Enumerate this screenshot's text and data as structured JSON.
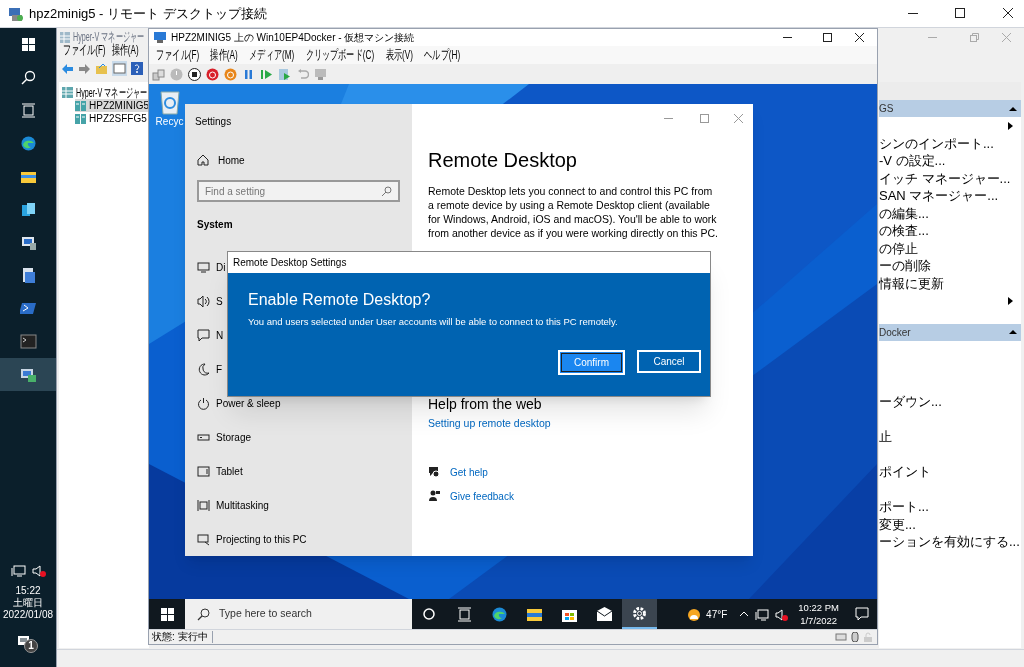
{
  "rdp_window": {
    "title": "hpz2minig5 - リモート デスクトップ接続"
  },
  "host_taskbar": {
    "items": [
      {
        "kind": "windows",
        "selected": false
      },
      {
        "kind": "search",
        "selected": false
      },
      {
        "kind": "taskview",
        "selected": false
      },
      {
        "kind": "edge",
        "selected": false
      },
      {
        "kind": "folder",
        "selected": false
      },
      {
        "kind": "app",
        "selected": false
      },
      {
        "kind": "server",
        "selected": false
      },
      {
        "kind": "document",
        "selected": false
      },
      {
        "kind": "powershell",
        "selected": false
      },
      {
        "kind": "terminal",
        "selected": false
      },
      {
        "kind": "hyperv",
        "selected": true
      }
    ],
    "time": "15:22",
    "day": "土曜日",
    "date": "2022/01/08",
    "notification_count": "1"
  },
  "hyperv_manager": {
    "title": "Hyper-V マネージャー",
    "menu": [
      "ファイル(F)",
      "操作(A)"
    ],
    "tree": [
      {
        "label": "Hyper-V マネージャー",
        "selected": false,
        "children": [
          {
            "label": "HPZ2MINIG5",
            "selected": true
          },
          {
            "label": "HPZ2SFFG5",
            "selected": false
          }
        ]
      }
    ],
    "actions": [
      {
        "header": "GS",
        "items": [
          {
            "kind": "submenu"
          },
          {
            "kind": "text",
            "label": "シンのインポート..."
          },
          {
            "kind": "text",
            "label": "-V の設定..."
          },
          {
            "kind": "text",
            "label": "イッチ マネージャー..."
          },
          {
            "kind": "text",
            "label": "SAN マネージャー..."
          },
          {
            "kind": "text",
            "label": "の編集..."
          },
          {
            "kind": "text",
            "label": "の検査..."
          },
          {
            "kind": "text",
            "label": "の停止"
          },
          {
            "kind": "text",
            "label": "ーの削除"
          },
          {
            "kind": "text",
            "label": "情報に更新"
          },
          {
            "kind": "submenu"
          }
        ]
      },
      {
        "header": "Docker",
        "items": [
          {
            "kind": "blank"
          },
          {
            "kind": "blank"
          },
          {
            "kind": "blank"
          },
          {
            "kind": "text",
            "label": "ーダウン..."
          },
          {
            "kind": "blank"
          },
          {
            "kind": "text",
            "label": "止"
          },
          {
            "kind": "blank"
          },
          {
            "kind": "text",
            "label": "ポイント"
          },
          {
            "kind": "blank"
          },
          {
            "kind": "text",
            "label": "ポート..."
          },
          {
            "kind": "text",
            "label": "変更..."
          },
          {
            "kind": "text",
            "label": "ーションを有効にする..."
          }
        ]
      }
    ]
  },
  "vm_window": {
    "title": "HPZ2MINIG5 上の Win10EP4Docker - 仮想マシン接続",
    "menu": [
      "ファイル(F)",
      "操作(A)",
      "メディア(M)",
      "クリップボード(C)",
      "表示(V)",
      "ヘルプ(H)"
    ],
    "status": "状態: 実行中"
  },
  "guest": {
    "desktop_icons": [
      {
        "label": "Recyc"
      }
    ],
    "settings": {
      "title": "Settings",
      "home": "Home",
      "search_placeholder": "Find a setting",
      "section": "System",
      "nav": [
        {
          "kind": "display",
          "label": "Di"
        },
        {
          "kind": "sound",
          "label": "S"
        },
        {
          "kind": "notifications",
          "label": "N"
        },
        {
          "kind": "focus",
          "label": "F"
        },
        {
          "kind": "power",
          "label": "Power & sleep"
        },
        {
          "kind": "storage",
          "label": "Storage"
        },
        {
          "kind": "tablet",
          "label": "Tablet"
        },
        {
          "kind": "multitasking",
          "label": "Multitasking"
        },
        {
          "kind": "projecting",
          "label": "Projecting to this PC"
        }
      ],
      "heading": "Remote Desktop",
      "description": "Remote Desktop lets you connect to and control this PC from a remote device by using a Remote Desktop client (available for Windows, Android, iOS and macOS). You'll be able to work from another device as if you were working directly on this PC.",
      "help_heading": "Help from the web",
      "help_links": [
        "Setting up remote desktop"
      ],
      "support_links": [
        {
          "kind": "help",
          "label": "Get help"
        },
        {
          "kind": "feedback",
          "label": "Give feedback"
        }
      ]
    },
    "dialog": {
      "title": "Remote Desktop Settings",
      "heading": "Enable Remote Desktop?",
      "message": "You and users selected under User accounts will be able to connect to this PC remotely.",
      "buttons": [
        {
          "label": "Confirm",
          "default": true
        },
        {
          "label": "Cancel",
          "default": false
        }
      ]
    },
    "taskbar": {
      "search_placeholder": "Type here to search",
      "apps": [
        {
          "kind": "cortana",
          "selected": false
        },
        {
          "kind": "taskview",
          "selected": false
        },
        {
          "kind": "edge",
          "selected": false
        },
        {
          "kind": "explorer",
          "selected": false
        },
        {
          "kind": "store",
          "selected": false
        },
        {
          "kind": "mail",
          "selected": false
        },
        {
          "kind": "settings",
          "selected": true
        }
      ],
      "temperature": "47°F",
      "time": "10:22 PM",
      "date": "1/7/2022"
    }
  }
}
